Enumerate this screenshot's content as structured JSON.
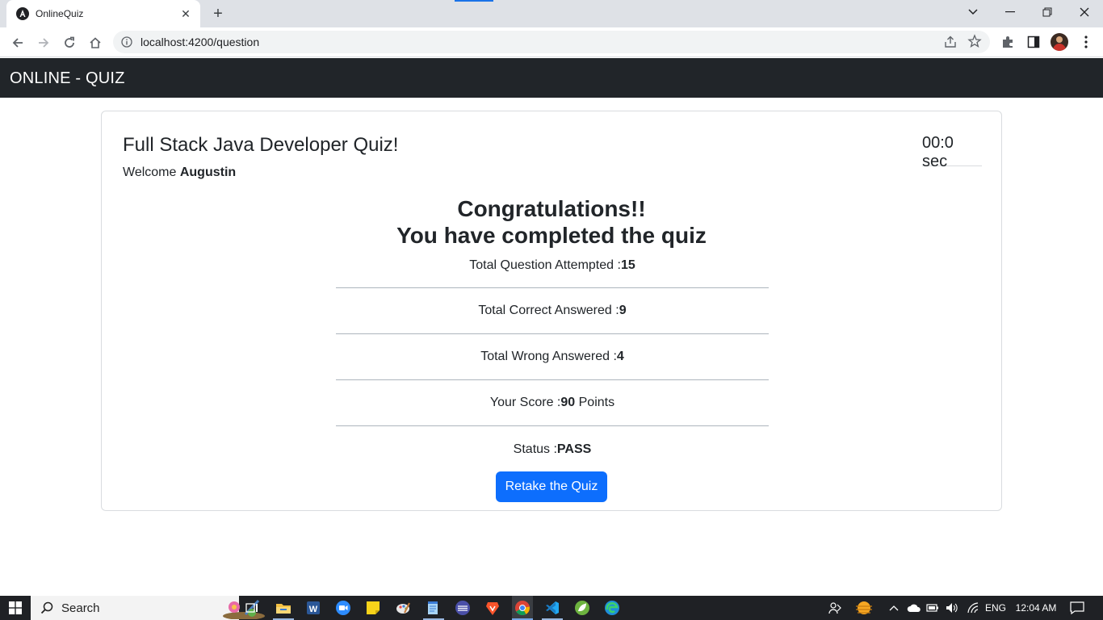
{
  "browser": {
    "tab_title": "OnlineQuiz",
    "url": "localhost:4200/question"
  },
  "app": {
    "brand": "ONLINE - QUIZ"
  },
  "quiz": {
    "title": "Full Stack Java Developer Quiz!",
    "welcome_prefix": "Welcome ",
    "user_name": "Augustin",
    "timer": "00:0 sec",
    "congrats_line1": "Congratulations!!",
    "congrats_line2": "You have completed the quiz",
    "stats": {
      "attempted_label": "Total Question Attempted : ",
      "attempted_value": "15",
      "correct_label": "Total Correct Answered : ",
      "correct_value": "9",
      "wrong_label": "Total Wrong Answered :",
      "wrong_value": "4",
      "score_label": "Your Score : ",
      "score_value": "90",
      "score_unit": " Points",
      "status_label": "Status :",
      "status_value": "PASS"
    },
    "retake_label": "Retake the Quiz"
  },
  "taskbar": {
    "search_label": "Search",
    "language": "ENG",
    "time": "12:04 AM"
  },
  "colors": {
    "navbar_bg": "#212529",
    "primary_button": "#0d6efd",
    "taskbar_bg": "#1f2125"
  }
}
